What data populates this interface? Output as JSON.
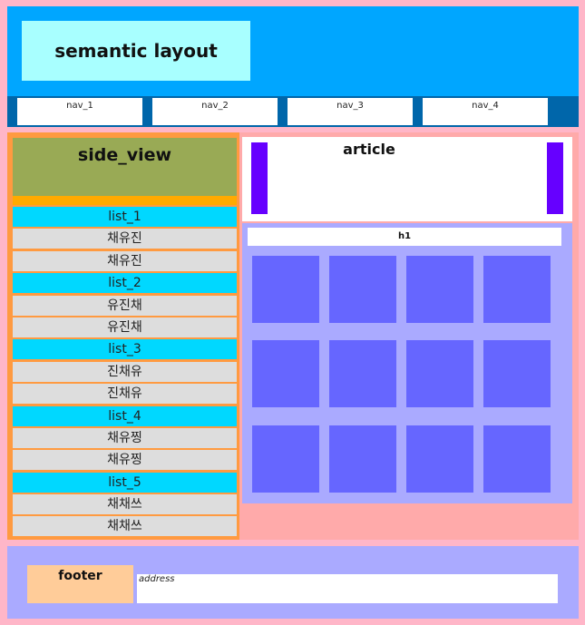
{
  "header": {
    "title": "semantic layout"
  },
  "nav": [
    "nav_1",
    "nav_2",
    "nav_3",
    "nav_4"
  ],
  "side": {
    "title": "side_view",
    "items": [
      {
        "label": "list_1",
        "cat": true
      },
      {
        "label": "채유진"
      },
      {
        "label": "채유진"
      },
      {
        "label": "list_2",
        "cat": true
      },
      {
        "label": "유진채"
      },
      {
        "label": "유진채"
      },
      {
        "label": "list_3",
        "cat": true
      },
      {
        "label": "진채유"
      },
      {
        "label": "진채유"
      },
      {
        "label": "list_4",
        "cat": true
      },
      {
        "label": "채유찡"
      },
      {
        "label": "채유찡"
      },
      {
        "label": "list_5",
        "cat": true
      },
      {
        "label": "채채쓰"
      },
      {
        "label": "채채쓰"
      }
    ]
  },
  "article": {
    "title": "article"
  },
  "section": {
    "heading": "h1",
    "tile_count": 12
  },
  "footer": {
    "label": "footer",
    "address": "address"
  }
}
